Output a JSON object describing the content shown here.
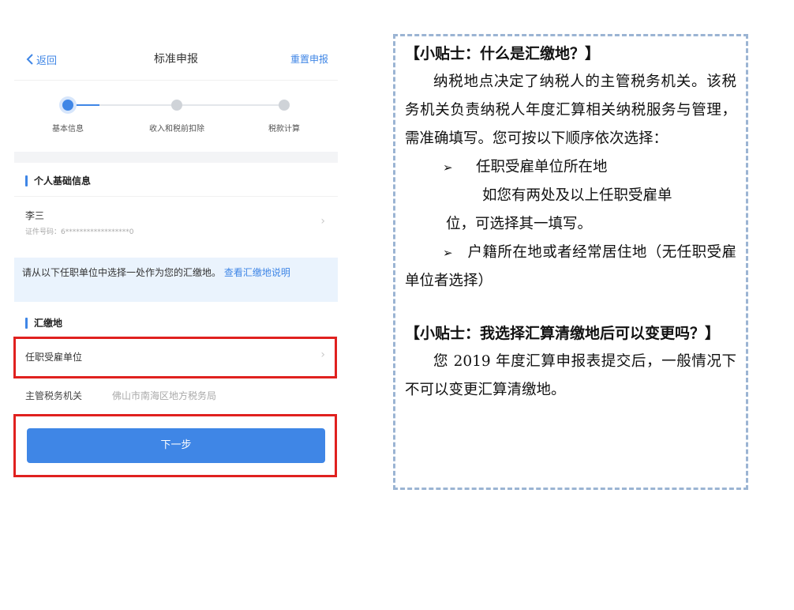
{
  "phone": {
    "nav": {
      "back_label": "返回",
      "title": "标准申报",
      "reset_label": "重置申报"
    },
    "steps": [
      {
        "label": "基本信息",
        "state": "active"
      },
      {
        "label": "收入和税前扣除",
        "state": "pending"
      },
      {
        "label": "税款计算",
        "state": "pending"
      }
    ],
    "personal": {
      "section_title": "个人基础信息",
      "name": "李三",
      "id_label": "证件号码：6******************0"
    },
    "notice": {
      "text": "请从以下任职单位中选择一处作为您的汇缴地。",
      "link": "查看汇缴地说明"
    },
    "remit": {
      "section_title": "汇缴地",
      "employer_label": "任职受雇单位",
      "tax_office_label": "主管税务机关",
      "tax_office_value": "佛山市南海区地方税务局"
    },
    "next_button": "下一步",
    "colors": {
      "accent": "#3f86e6",
      "highlight": "#e0211f"
    }
  },
  "tips": {
    "tip1_title": "【小贴士：什么是汇缴地？】",
    "tip1_body": "纳税地点决定了纳税人的主管税务机关。该税务机关负责纳税人年度汇算相关纳税服务与管理，需准确填写。您可按以下顺序依次选择：",
    "bullet1": "任职受雇单位所在地",
    "bullet1_sub_a": "如您有两处及以上任职受雇单",
    "bullet1_sub_b": "位，可选择其一填写。",
    "bullet2": "户籍所在地或者经常居住地（无任职受雇单位者选择）",
    "tip2_title": "【小贴士：我选择汇算清缴地后可以变更吗？】",
    "tip2_body": "您 2019 年度汇算申报表提交后，一般情况下不可以变更汇算清缴地。"
  }
}
